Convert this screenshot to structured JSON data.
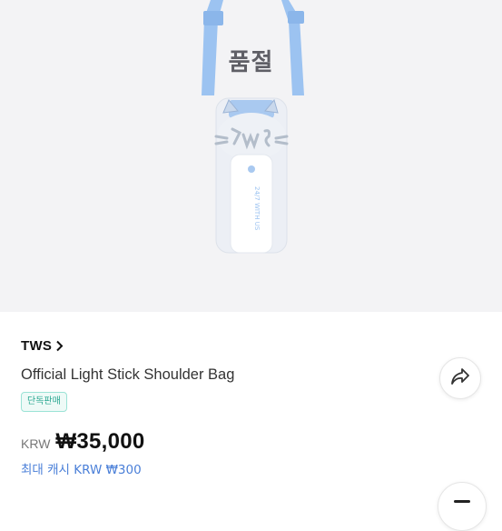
{
  "hero": {
    "soldout_label": "품절",
    "product_icon": "light-stick-shoulder-bag-image"
  },
  "product": {
    "brand": "TWS",
    "title": "Official Light Stick Shoulder Bag",
    "badge": "단독판매",
    "currency": "KRW",
    "price": "₩35,000",
    "cash_back": "최대 캐시 KRW ₩300",
    "stick_text": "24/7 WITH US"
  },
  "actions": {
    "share_icon": "share-icon",
    "floating_icon": "menu-icon"
  },
  "colors": {
    "accent_blue": "#4a7fd8",
    "badge_green": "#2ba892",
    "strap_blue": "#9cc3f1"
  }
}
